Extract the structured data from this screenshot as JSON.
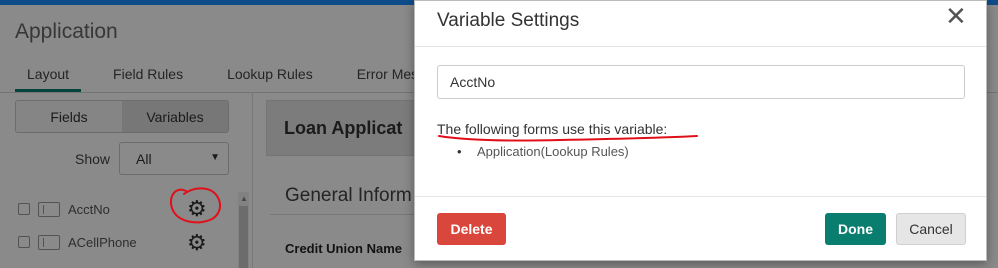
{
  "app": {
    "title": "Application",
    "tabs": [
      {
        "label": "Layout",
        "active": true
      },
      {
        "label": "Field Rules",
        "active": false
      },
      {
        "label": "Lookup Rules",
        "active": false
      },
      {
        "label": "Error Messa",
        "active": false
      }
    ]
  },
  "sidebar": {
    "segments": [
      {
        "label": "Fields",
        "active": false
      },
      {
        "label": "Variables",
        "active": true
      }
    ],
    "show_label": "Show",
    "show_value": "All",
    "variables": [
      {
        "name": "AcctNo",
        "settings_icon": "gear-icon"
      },
      {
        "name": "ACellPhone",
        "settings_icon": "gear-icon"
      }
    ]
  },
  "form": {
    "title": "Loan Applicat",
    "section_title": "General Inform",
    "field_label": "Credit Union Name"
  },
  "modal": {
    "title": "Variable Settings",
    "close_icon": "close-icon",
    "variable_name": "AcctNo",
    "usage_heading": "The following forms use this variable:",
    "usage_forms": [
      "Application(Lookup Rules)"
    ],
    "delete_label": "Delete",
    "done_label": "Done",
    "cancel_label": "Cancel"
  },
  "colors": {
    "accent": "#0a7e6e",
    "danger": "#d9463b",
    "annotation": "#e0101a",
    "topbar": "#0f4c8a"
  }
}
